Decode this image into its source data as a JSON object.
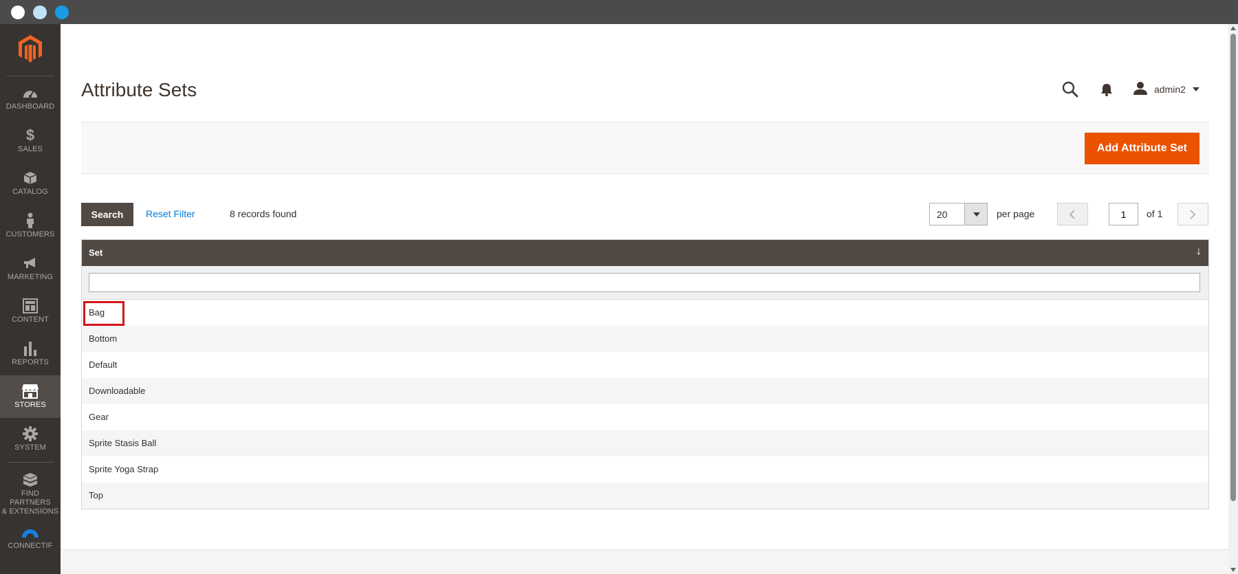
{
  "window": {
    "controls": [
      "close",
      "minimize",
      "maximize"
    ]
  },
  "sidebar": {
    "logo": "magento-logo-icon",
    "items": [
      {
        "label": "DASHBOARD",
        "icon": "speedometer-icon",
        "active": false
      },
      {
        "label": "SALES",
        "icon": "dollar-icon",
        "active": false
      },
      {
        "label": "CATALOG",
        "icon": "box-icon",
        "active": false
      },
      {
        "label": "CUSTOMERS",
        "icon": "person-icon",
        "active": false
      },
      {
        "label": "MARKETING",
        "icon": "megaphone-icon",
        "active": false
      },
      {
        "label": "CONTENT",
        "icon": "layout-icon",
        "active": false
      },
      {
        "label": "REPORTS",
        "icon": "bar-chart-icon",
        "active": false
      },
      {
        "label": "STORES",
        "icon": "storefront-icon",
        "active": true
      },
      {
        "label": "SYSTEM",
        "icon": "gear-icon",
        "active": false
      },
      {
        "label": "FIND PARTNERS\n& EXTENSIONS",
        "icon": "cubes-icon",
        "active": false
      },
      {
        "label": "CONNECTIF",
        "icon": "connectif-icon",
        "active": false
      }
    ]
  },
  "header": {
    "title": "Attribute Sets",
    "user": "admin2"
  },
  "actions": {
    "add_label": "Add Attribute Set"
  },
  "toolbar": {
    "search_label": "Search",
    "reset_label": "Reset Filter",
    "records": "8 records found",
    "per_page_value": "20",
    "per_page_label": "per page",
    "current_page": "1",
    "total_pages": "of 1"
  },
  "grid": {
    "column": "Set",
    "sort_indicator": "↓",
    "filter_value": "",
    "rows": [
      "Bag",
      "Bottom",
      "Default",
      "Downloadable",
      "Gear",
      "Sprite Stasis Ball",
      "Sprite Yoga Strap",
      "Top"
    ]
  },
  "colors": {
    "sidebar_bg": "#373330",
    "accent": "#eb5202",
    "grid_header": "#514943",
    "link": "#007bdb",
    "highlight": "#d4141c"
  }
}
